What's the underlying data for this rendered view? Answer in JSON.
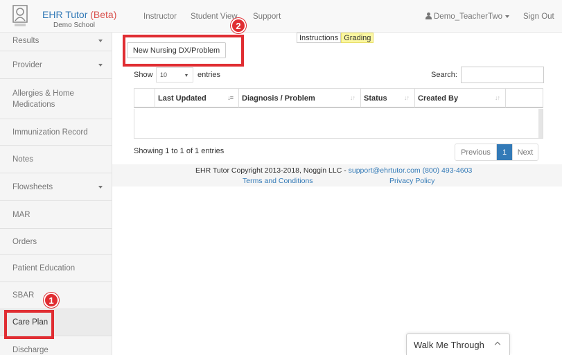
{
  "header": {
    "brand_title": "EHR Tutor",
    "brand_beta": "(Beta)",
    "school": "Demo School",
    "nav": [
      "Instructor",
      "Student View",
      "Support"
    ],
    "user": "Demo_TeacherTwo",
    "sign_out": "Sign Out"
  },
  "sidebar": {
    "items": [
      {
        "label": "Results",
        "dropdown": true
      },
      {
        "label": "Provider",
        "dropdown": true
      },
      {
        "label": "Allergies & Home Medications",
        "dropdown": false
      },
      {
        "label": "Immunization Record",
        "dropdown": false
      },
      {
        "label": "Notes",
        "dropdown": false
      },
      {
        "label": "Flowsheets",
        "dropdown": true
      },
      {
        "label": "MAR",
        "dropdown": false
      },
      {
        "label": "Orders",
        "dropdown": false
      },
      {
        "label": "Patient Education",
        "dropdown": false
      },
      {
        "label": "SBAR",
        "dropdown": false
      },
      {
        "label": "Care Plan",
        "dropdown": false,
        "active": true
      },
      {
        "label": "Discharge",
        "dropdown": false
      }
    ]
  },
  "main": {
    "new_button": "New Nursing DX/Problem",
    "tabs": [
      "Instructions",
      "Grading"
    ],
    "show_label": "Show",
    "page_length": "10",
    "entries_label": "entries",
    "search_label": "Search:",
    "search_value": "",
    "columns": [
      "Last Updated",
      "Diagnosis / Problem",
      "Status",
      "Created By"
    ],
    "rows": [],
    "info": "Showing 1 to 1 of 1 entries",
    "pagination": {
      "prev": "Previous",
      "current": "1",
      "next": "Next"
    }
  },
  "footer": {
    "copyright": "EHR Tutor Copyright 2013-2018, Noggin LLC -",
    "contact": "support@ehrtutor.com (800) 493-4603",
    "terms": "Terms and Conditions",
    "privacy": "Privacy Policy"
  },
  "annotations": {
    "badge1": "1",
    "badge2": "2"
  },
  "walkme": {
    "label": "Walk Me Through"
  },
  "colors": {
    "link": "#337ab7",
    "beta": "#d9534f",
    "highlight": "#e02d32",
    "grading": "#fbf7a1"
  }
}
